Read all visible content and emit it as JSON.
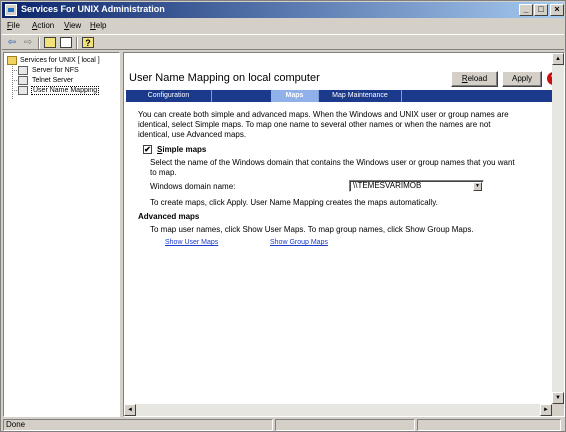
{
  "window": {
    "title": "Services For UNIX Administration",
    "controls": {
      "minimize": "_",
      "maximize": "□",
      "close": "×"
    }
  },
  "menu": [
    {
      "prefix": "",
      "accel": "F",
      "rest": "ile"
    },
    {
      "prefix": "",
      "accel": "A",
      "rest": "ction"
    },
    {
      "prefix": "",
      "accel": "V",
      "rest": "iew"
    },
    {
      "prefix": "",
      "accel": "H",
      "rest": "elp"
    }
  ],
  "toolbar": {
    "icons": [
      "back-arrow-icon",
      "forward-arrow-icon",
      "up-folder-icon",
      "show-hide-tree-icon",
      "properties-help-icon"
    ],
    "back": "⇦",
    "forward": "⇨",
    "help": "?"
  },
  "tree": {
    "root": "Services for UNIX [ local ]",
    "items": [
      "Server for NFS",
      "Telnet Server",
      "User Name Mapping"
    ],
    "selected": "User Name Mapping"
  },
  "main": {
    "title": "User Name Mapping on local computer",
    "reload_label": "Reload",
    "reload_accel": "R",
    "reload_rest": "eload",
    "apply_label": "Apply",
    "help_glyph": "?",
    "tabs": [
      {
        "label": "Configuration",
        "active": false
      },
      {
        "label": "Maps",
        "active": true
      },
      {
        "label": "Map Maintenance",
        "active": false
      }
    ],
    "intro_line1": "You can create both simple and advanced maps. When the Windows and UNIX user or group names are",
    "intro_line2": "identical, select Simple maps. To map one name to several other names or when the names are not",
    "intro_line3": "identical, use Advanced maps.",
    "simple_maps_checked": true,
    "check_glyph": "✔",
    "simple_maps_accel": "S",
    "simple_maps_rest": "imple maps",
    "domain_desc_line1": "Select the name of the Windows domain that contains the Windows user or group names that you want",
    "domain_desc_line2": "to map.",
    "domain_label": "Windows domain name:",
    "domain_value": "\\\\TEMESVARIMOB",
    "create_maps_text": "To create maps, click Apply. User Name Mapping creates the maps automatically.",
    "advanced_heading": "Advanced maps",
    "advanced_text": "To map user names, click Show User Maps. To map group names, click Show Group Maps.",
    "show_user_maps": "Show User Maps",
    "show_group_maps": "Show Group Maps"
  },
  "scroll": {
    "up": "▲",
    "down": "▼",
    "left": "◄",
    "right": "►"
  },
  "status": {
    "text": "Done"
  },
  "colors": {
    "title_start": "#0a246a",
    "title_end": "#a6caf0",
    "tabbar": "#1c3a8c",
    "tab_active": "#8fb0e8",
    "link": "#1c3acc",
    "help": "#cc1010"
  }
}
